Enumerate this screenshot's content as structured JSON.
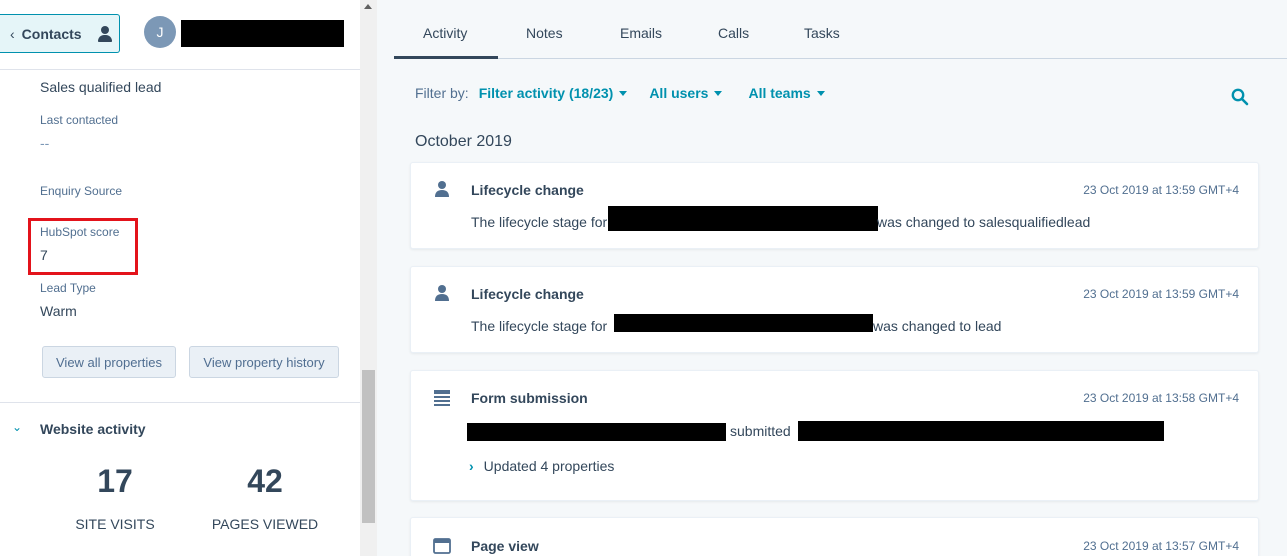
{
  "left": {
    "back_button": "Contacts",
    "avatar_initial": "J",
    "properties": {
      "lifecycle_value": "Sales qualified lead",
      "last_contacted_label": "Last contacted",
      "last_contacted_value": "--",
      "enquiry_source_label": "Enquiry Source",
      "hubspot_score_label": "HubSpot score",
      "hubspot_score_value": "7",
      "lead_type_label": "Lead Type",
      "lead_type_value": "Warm"
    },
    "buttons": {
      "view_all": "View all properties",
      "view_history": "View property history"
    },
    "website_activity": {
      "title": "Website activity",
      "site_visits_value": "17",
      "site_visits_label": "SITE VISITS",
      "pages_viewed_value": "42",
      "pages_viewed_label": "PAGES VIEWED"
    }
  },
  "tabs": [
    "Activity",
    "Notes",
    "Emails",
    "Calls",
    "Tasks"
  ],
  "filter": {
    "label": "Filter by:",
    "activity": "Filter activity (18/23)",
    "users": "All users",
    "teams": "All teams"
  },
  "month": "October 2019",
  "cards": [
    {
      "icon": "person-icon",
      "title": "Lifecycle change",
      "time": "23 Oct 2019 at 13:59 GMT+4",
      "body_prefix": "The lifecycle stage for",
      "body_suffix": "was changed to salesqualifiedlead"
    },
    {
      "icon": "person-icon",
      "title": "Lifecycle change",
      "time": "23 Oct 2019 at 13:59 GMT+4",
      "body_prefix": "The lifecycle stage for",
      "body_suffix": "was changed to lead"
    },
    {
      "icon": "form-icon",
      "title": "Form submission",
      "time": "23 Oct 2019 at 13:58 GMT+4",
      "body_middle": "submitted",
      "expander": "Updated 4 properties"
    },
    {
      "icon": "browser-icon",
      "title": "Page view",
      "time": "23 Oct 2019 at 13:57 GMT+4"
    }
  ],
  "colors": {
    "accent": "#0091ae",
    "text": "#33475b",
    "highlight": "#e3131b"
  }
}
